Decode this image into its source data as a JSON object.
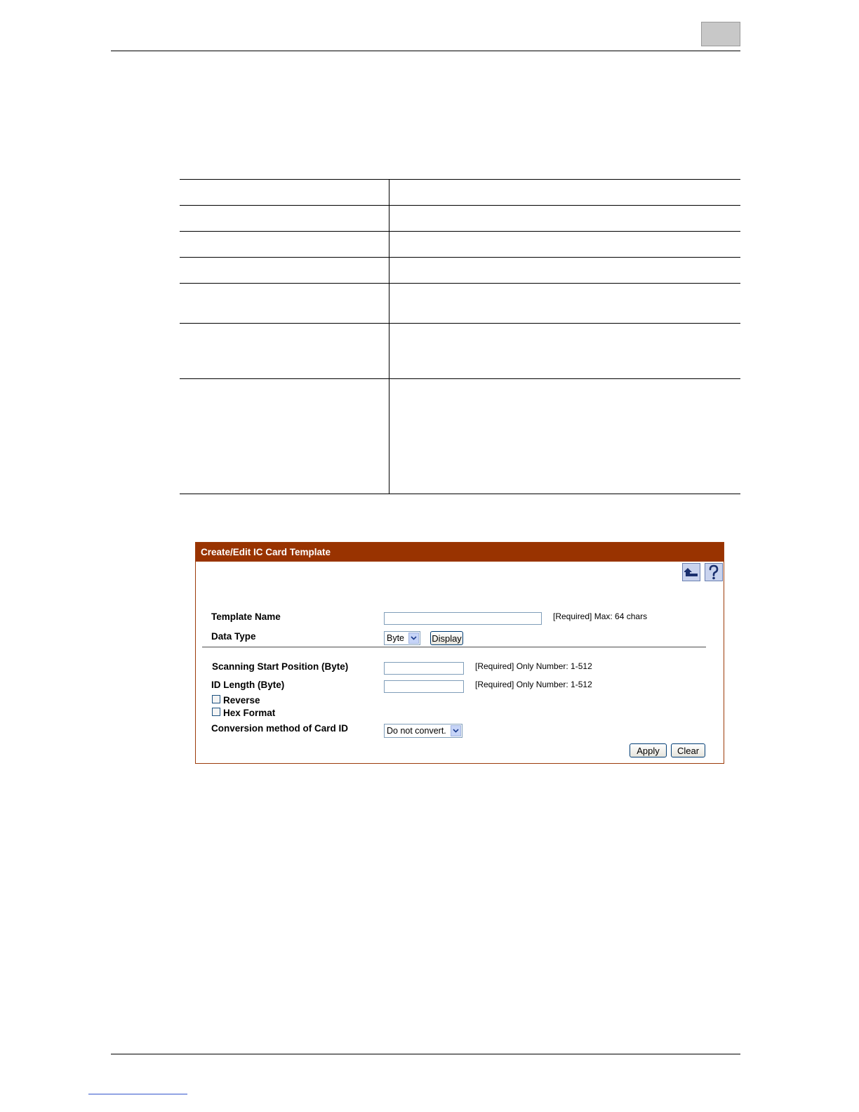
{
  "panel": {
    "title": "Create/Edit IC Card Template",
    "icons": {
      "up": "up-arrow-icon",
      "help": "help-icon"
    },
    "header_color": "#993300",
    "template_name": {
      "label": "Template Name",
      "value": "",
      "note": "[Required] Max: 64 chars"
    },
    "data_type": {
      "label": "Data Type",
      "selected": "Byte",
      "display_label": "Display"
    },
    "scanning_start": {
      "label": "Scanning Start Position (Byte)",
      "value": "",
      "note": "[Required] Only Number: 1-512"
    },
    "id_length": {
      "label": "ID Length (Byte)",
      "value": "",
      "note": "[Required] Only Number: 1-512"
    },
    "reverse": {
      "label": "Reverse",
      "checked": false
    },
    "hex_format": {
      "label": "Hex Format",
      "checked": false
    },
    "conversion": {
      "label": "Conversion method of Card ID",
      "selected": "Do not convert."
    },
    "apply_label": "Apply",
    "clear_label": "Clear"
  }
}
